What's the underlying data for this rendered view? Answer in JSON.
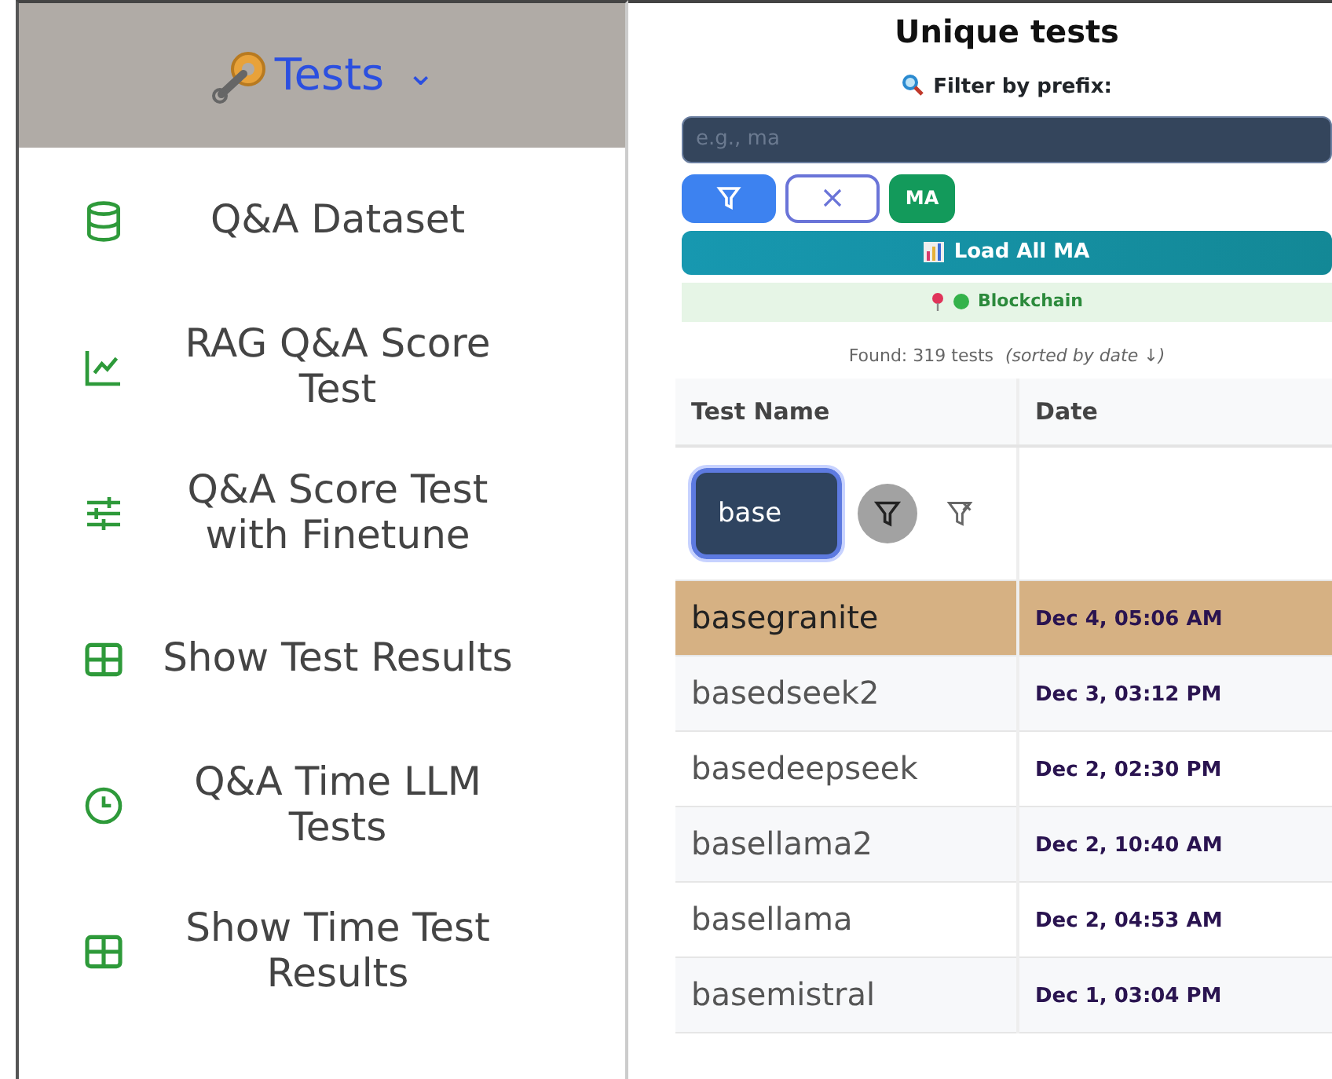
{
  "sidebar": {
    "header": {
      "label": "Tests",
      "caret": "⌄"
    },
    "items": [
      {
        "label": "Q&A Dataset",
        "kind": "database"
      },
      {
        "label": "RAG Q&A Score Test",
        "kind": "chart"
      },
      {
        "label": "Q&A Score Test with Finetune",
        "kind": "sliders"
      },
      {
        "label": "Show Test Results",
        "kind": "table"
      },
      {
        "label": "Q&A Time LLM Tests",
        "kind": "clock"
      },
      {
        "label": "Show Time Test Results",
        "kind": "table"
      }
    ]
  },
  "main": {
    "title": "Unique tests",
    "filter_label": "Filter by prefix:",
    "prefix_field": {
      "placeholder": "e.g., ma"
    },
    "ma_button": "MA",
    "load_button": "Load All MA",
    "tag": "Blockchain",
    "found": "Found: 319 tests",
    "sort_note": "(sorted by date ↓)",
    "table": {
      "columns": [
        "Test Name",
        "Date"
      ],
      "name_filter": {
        "value": "base"
      },
      "rows": [
        {
          "name": "basegranite",
          "date": "Dec 4, 05:06 AM",
          "selected": true
        },
        {
          "name": "basedseek2",
          "date": "Dec 3, 03:12 PM",
          "selected": false
        },
        {
          "name": "basedeepseek",
          "date": "Dec 2, 02:30 PM",
          "selected": false
        },
        {
          "name": "basellama2",
          "date": "Dec 2, 10:40 AM",
          "selected": false
        },
        {
          "name": "basellama",
          "date": "Dec 2, 04:53 AM",
          "selected": false
        },
        {
          "name": "basemistral",
          "date": "Dec 1, 03:04 PM",
          "selected": false
        }
      ]
    }
  }
}
